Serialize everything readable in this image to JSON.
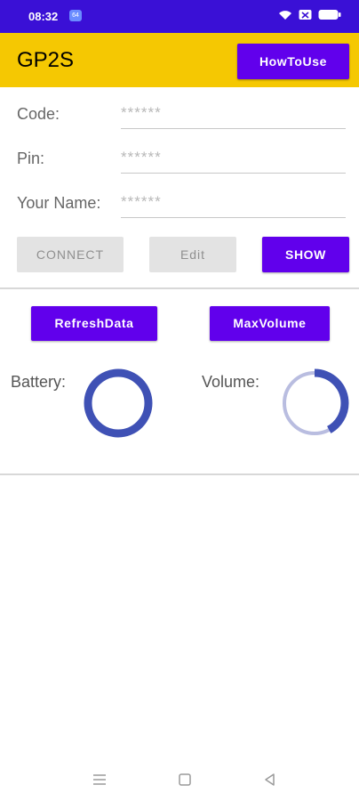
{
  "status_bar": {
    "time": "08:32",
    "app_badge": "64",
    "color": "#3a10d6"
  },
  "app_bar": {
    "title": "GP2S",
    "how_to_use_label": "HowToUse",
    "color": "#f5c802"
  },
  "form": {
    "code": {
      "label": "Code:",
      "value": "******"
    },
    "pin": {
      "label": "Pin:",
      "value": "******"
    },
    "name": {
      "label": "Your Name:",
      "value": "******"
    }
  },
  "actions": {
    "connect_label": "CONNECT",
    "edit_label": "Edit",
    "show_label": "SHOW",
    "accent_color": "#6100ec"
  },
  "data_panel": {
    "refresh_label": "RefreshData",
    "max_volume_label": "MaxVolume",
    "battery": {
      "label": "Battery:",
      "level_fraction": 1.0
    },
    "volume": {
      "label": "Volume:",
      "level_fraction": 0.42
    },
    "ring_color": "#3f51b5",
    "ring_track_color": "#b9bde0"
  },
  "nav": {
    "items": [
      "menu-icon",
      "home-icon",
      "back-icon"
    ]
  }
}
